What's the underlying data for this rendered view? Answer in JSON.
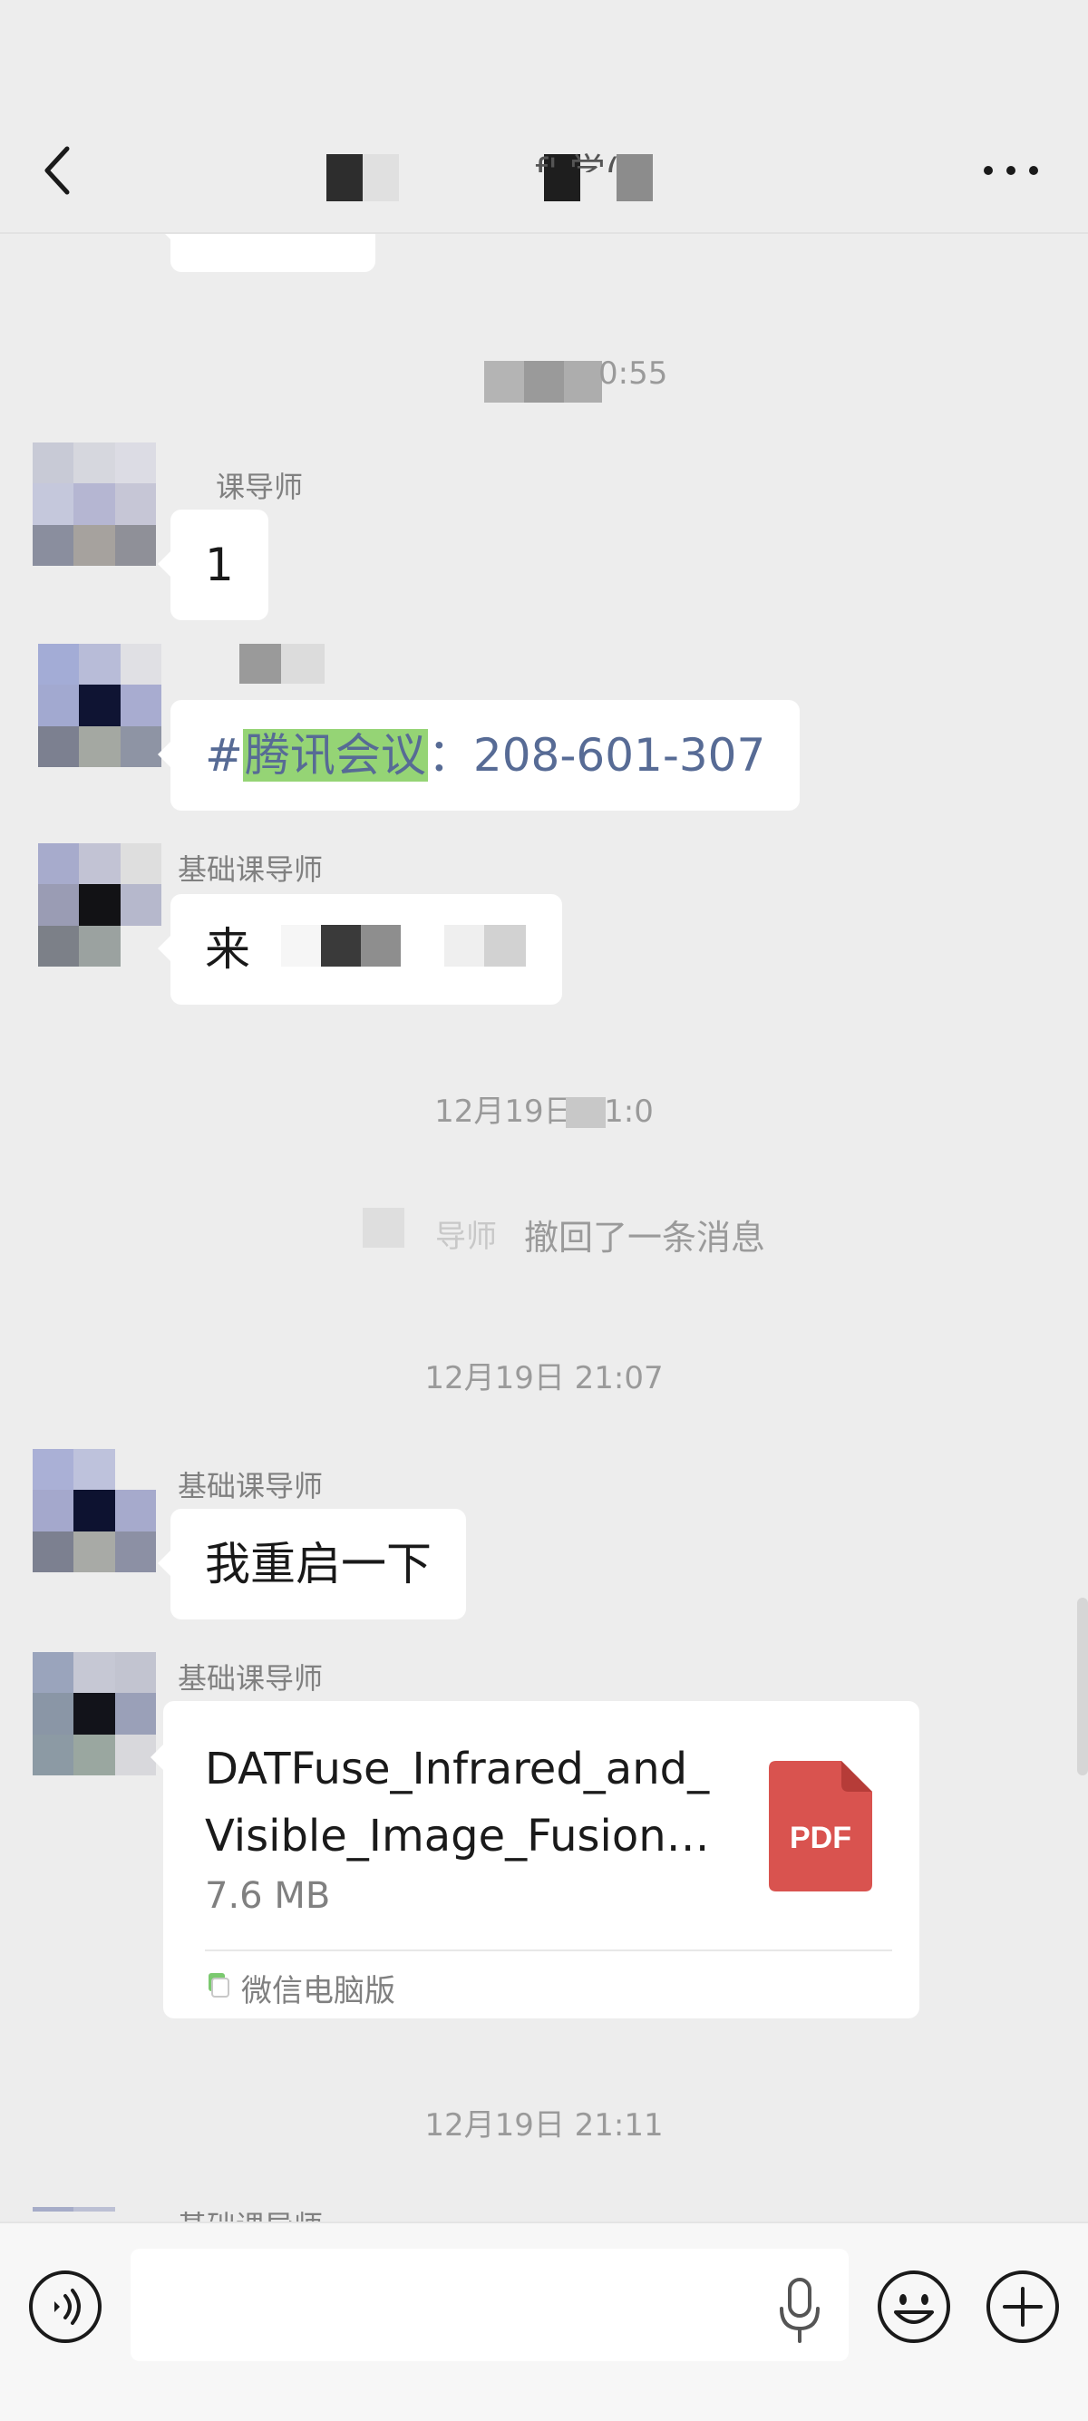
{
  "header": {
    "title_fragment": "f' 学(",
    "back_icon": "chevron-left-icon",
    "more_icon": "more-dots-icon"
  },
  "chat": {
    "top_partial_bubble": "",
    "time_1_suffix": "0:55",
    "messages": [
      {
        "sender": "课导师",
        "text": "1"
      },
      {
        "sender": "",
        "link_prefix": "#",
        "link_highlight": "腾讯会议",
        "link_rest": "：208-601-307"
      },
      {
        "sender": "基础课导师",
        "text": "来"
      }
    ],
    "time_2": "12月19日 21:0",
    "recall_notice": "撤回了一条消息",
    "recall_name_fragment": "导师",
    "time_3": "12月19日 21:07",
    "msg_restart": {
      "sender": "基础课导师",
      "text": "我重启一下"
    },
    "file_message": {
      "sender": "基础课导师",
      "file_name": "DATFuse_Infrared_and_Visible_Image_Fusion…",
      "file_size": "7.6 MB",
      "file_type": "PDF",
      "source": "微信电脑版",
      "pdf_color": "#d9534f"
    },
    "time_4": "12月19日 21:11",
    "last_sender_partial": "基础课导师"
  },
  "input_bar": {
    "placeholder": "",
    "voice_icon": "voice-icon",
    "mic_icon": "microphone-icon",
    "emoji_icon": "emoji-icon",
    "plus_icon": "plus-icon"
  },
  "colors": {
    "background": "#ededed",
    "bubble": "#ffffff",
    "link": "#576b95",
    "highlight": "#95d475"
  }
}
